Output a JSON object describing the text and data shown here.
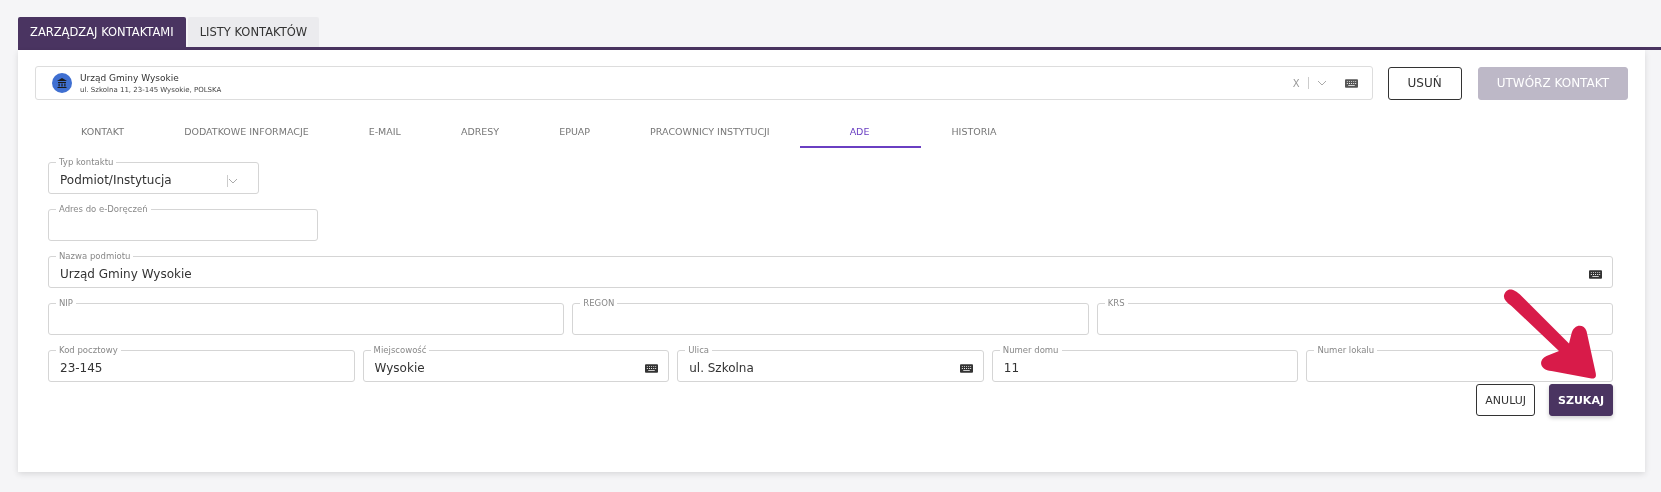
{
  "tabs": [
    {
      "label": "ZARZĄDZAJ KONTAKTAMI",
      "selected": true
    },
    {
      "label": "LISTY KONTAKTÓW",
      "selected": false
    }
  ],
  "contact": {
    "name": "Urząd Gminy Wysokie",
    "address": "ul. Szkolna 11, 23-145 Wysokie, POLSKA",
    "clear": "X"
  },
  "header_buttons": [
    {
      "label": "USUŃ",
      "disabled": false
    },
    {
      "label": "UTWÓRZ KONTAKT",
      "disabled": true
    }
  ],
  "subtabs": [
    {
      "label": "KONTAKT",
      "selected": false
    },
    {
      "label": "DODATKOWE INFORMACJE",
      "selected": false
    },
    {
      "label": "E-MAIL",
      "selected": false
    },
    {
      "label": "ADRESY",
      "selected": false
    },
    {
      "label": "EPUAP",
      "selected": false
    },
    {
      "label": "PRACOWNICY INSTYTUCJI",
      "selected": false
    },
    {
      "label": "ADE",
      "selected": true
    },
    {
      "label": "HISTORIA",
      "selected": false
    }
  ],
  "form_rows": [
    [
      {
        "kind": "select",
        "label": "Typ kontaktu",
        "value": "Podmiot/Instytucja",
        "keyboard": false
      }
    ],
    [
      {
        "kind": "short",
        "label": "Adres do e-Doręczeń",
        "keyboard": false
      }
    ],
    [
      {
        "kind": "text",
        "label": "Nazwa podmiotu",
        "value": "Urząd Gminy Wysokie",
        "keyboard": true
      }
    ],
    [
      {
        "kind": "text",
        "label": "NIP",
        "keyboard": false
      },
      {
        "kind": "text",
        "label": "REGON",
        "keyboard": false
      },
      {
        "kind": "text",
        "label": "KRS",
        "keyboard": false
      }
    ],
    [
      {
        "kind": "text",
        "label": "Kod pocztowy",
        "value": "23-145",
        "keyboard": false
      },
      {
        "kind": "text",
        "label": "Miejscowość",
        "value": "Wysokie",
        "keyboard": true
      },
      {
        "kind": "text",
        "label": "Ulica",
        "value": "ul. Szkolna",
        "keyboard": true
      },
      {
        "kind": "text",
        "label": "Numer domu",
        "value": "11",
        "keyboard": false
      },
      {
        "kind": "text",
        "label": "Numer lokalu",
        "keyboard": false
      }
    ]
  ],
  "actions": [
    {
      "label": "ANULUJ",
      "kind": "outline"
    },
    {
      "label": "SZUKAJ",
      "kind": "primary"
    }
  ]
}
